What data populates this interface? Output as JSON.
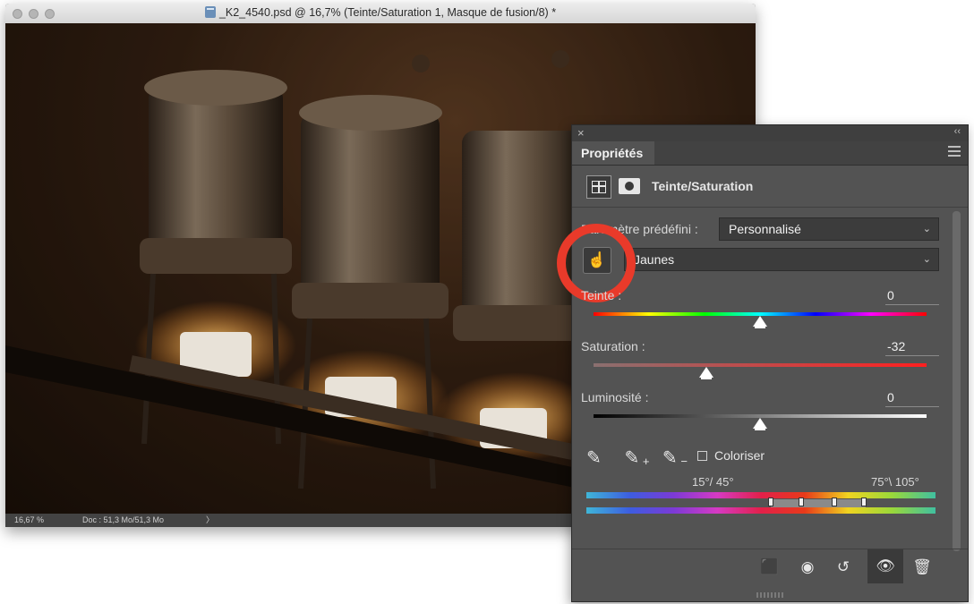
{
  "document": {
    "title": "_K2_4540.psd @ 16,7% (Teinte/Saturation 1, Masque de fusion/8) *",
    "status_zoom": "16,67 %",
    "status_doc": "Doc : 51,3 Mo/51,3 Mo",
    "status_arrow": "〉"
  },
  "panel": {
    "close_glyph": "×",
    "collapse_glyph": "‹‹",
    "tab_label": "Propriétés",
    "adjustment_label": "Teinte/Saturation",
    "preset_label": "Paramètre prédéfini :",
    "preset_value": "Personnalisé",
    "channel_value": "Jaunes",
    "chevron": "⌄",
    "hue": {
      "label": "Teinte :",
      "value": "0",
      "level": 0.5
    },
    "saturation": {
      "label": "Saturation :",
      "value": "-32",
      "level": 0.34
    },
    "lightness": {
      "label": "Luminosité :",
      "value": "0",
      "level": 0.5
    },
    "colorize_label": "Coloriser",
    "range_left": "15°/ 45°",
    "range_right": "75°\\ 105°",
    "footer_icons": [
      "clip-icon",
      "view-previous-icon",
      "reset-icon",
      "visibility-icon",
      "delete-icon"
    ]
  },
  "colors": {
    "highlight_ring": "#e93a2a",
    "panel_bg": "#535353"
  }
}
